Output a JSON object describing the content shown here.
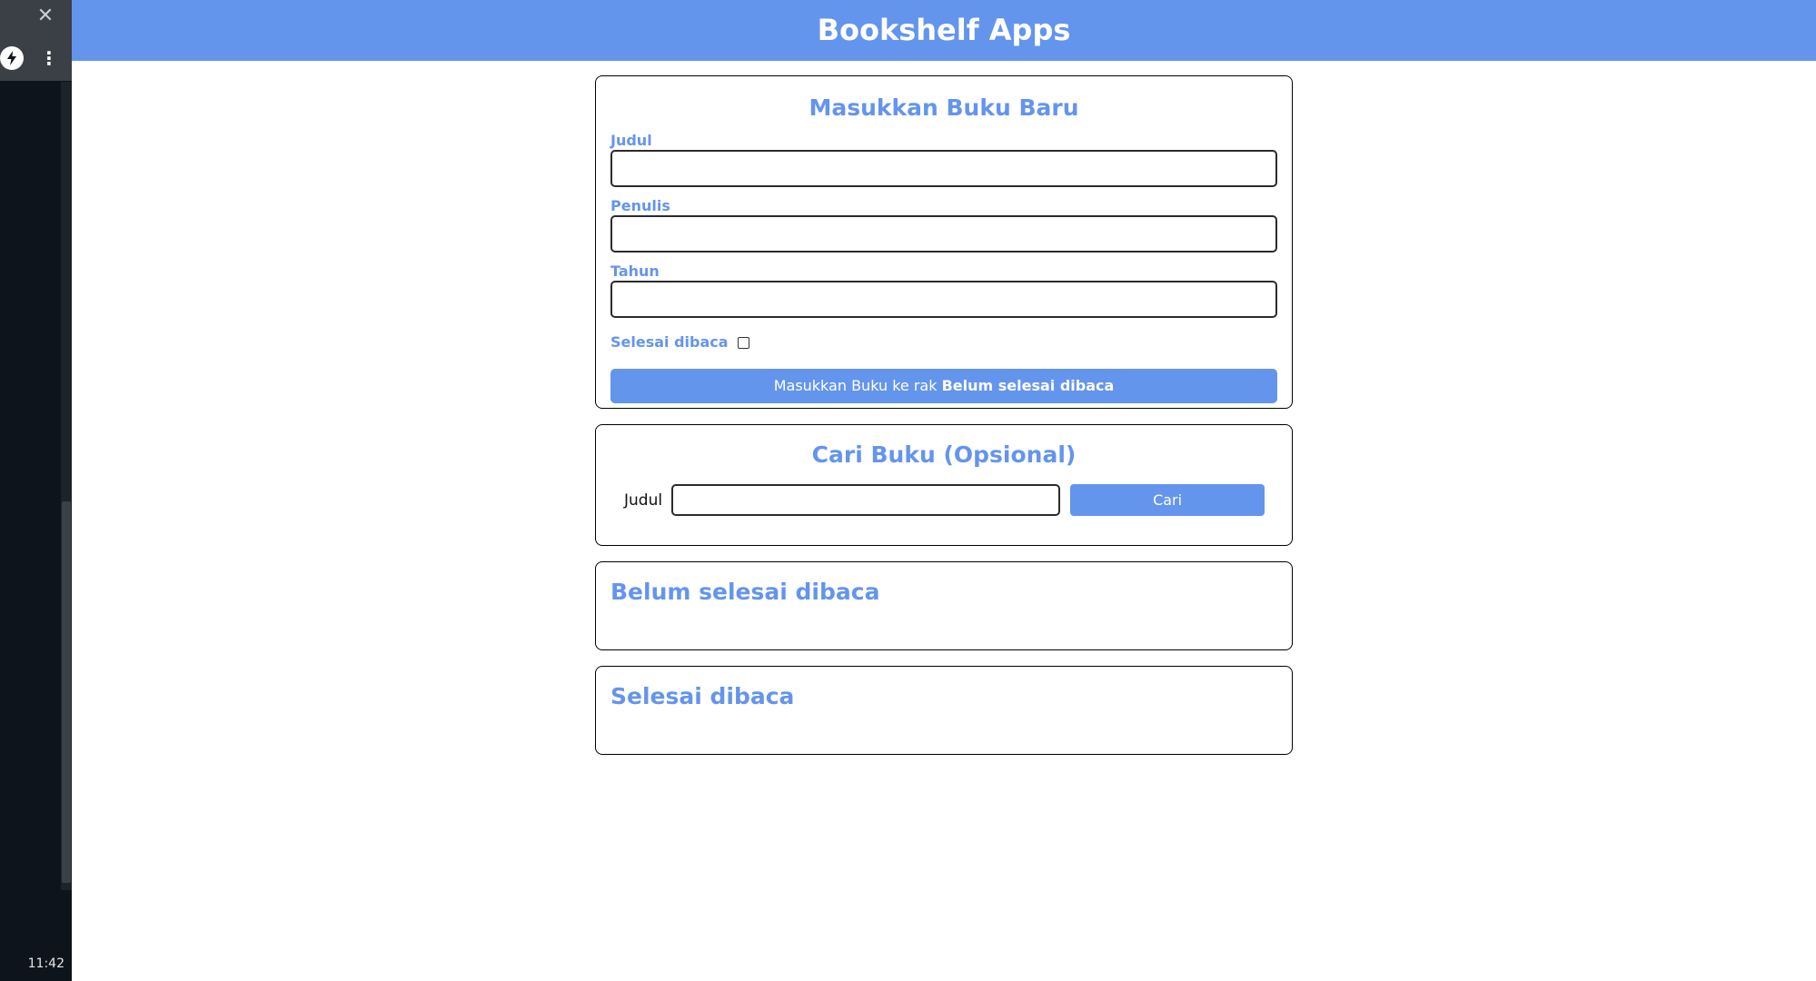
{
  "sidebar": {
    "close_glyph": "✕",
    "extension_icon": "lightning-icon",
    "menu_glyph": "⋮",
    "clock": "11:42"
  },
  "app": {
    "title": "Bookshelf Apps",
    "accent_color": "#6495ed"
  },
  "input_section": {
    "title": "Masukkan Buku Baru",
    "title_label": "Judul",
    "title_value": "",
    "author_label": "Penulis",
    "author_value": "",
    "year_label": "Tahun",
    "year_value": "",
    "complete_label": "Selesai dibaca",
    "complete_checked": false,
    "submit_prefix": "Masukkan Buku ke rak",
    "submit_target": "Belum selesai dibaca"
  },
  "search_section": {
    "title": "Cari Buku (Opsional)",
    "label": "Judul",
    "value": "",
    "button_label": "Cari"
  },
  "shelves": {
    "incomplete_title": "Belum selesai dibaca",
    "complete_title": "Selesai dibaca"
  }
}
